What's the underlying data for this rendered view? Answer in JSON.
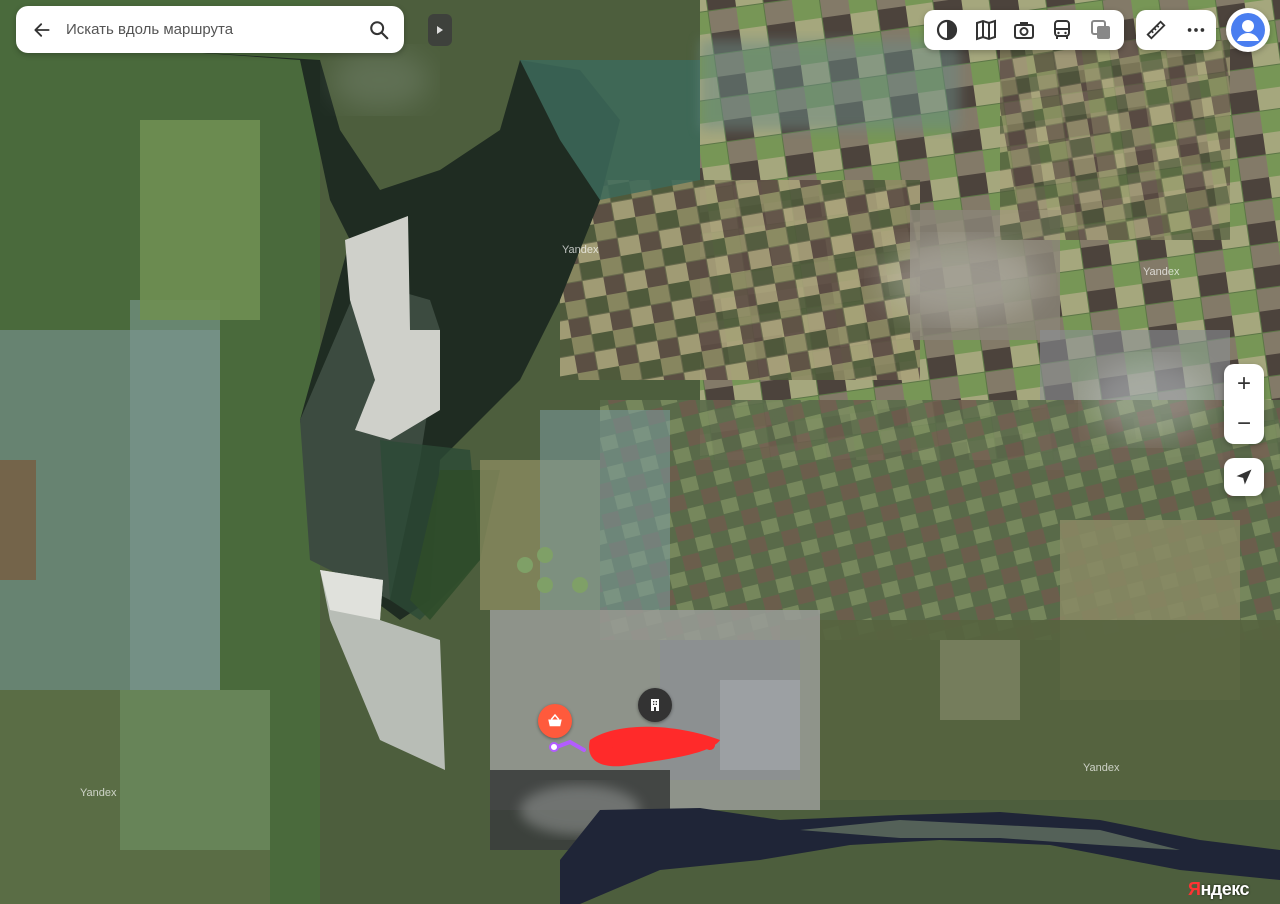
{
  "search": {
    "placeholder": "Искать вдоль маршрута"
  },
  "map": {
    "watermark": "Yandex",
    "logo_first_letter": "Я",
    "logo_rest": "ндекс"
  },
  "zoom": {
    "in_label": "+",
    "out_label": "−"
  },
  "icons": {
    "back": "arrow-left-icon",
    "search": "search-icon",
    "collapse": "chevron-right-icon",
    "layers": "layers-icon",
    "traffic": "traffic-icon",
    "panorama": "camera-icon",
    "transit": "bus-icon",
    "map_type": "map-type-icon",
    "ruler": "ruler-icon",
    "more": "more-icon",
    "profile": "user-avatar-icon",
    "geolocation": "geolocation-icon",
    "shop": "shopping-basket-icon",
    "building": "building-icon"
  },
  "colors": {
    "route": "#b35cff",
    "shop_marker": "#ff5a3c",
    "building_marker": "#333333",
    "scribble": "#ff2a2a",
    "avatar": "#4a7ef0"
  }
}
